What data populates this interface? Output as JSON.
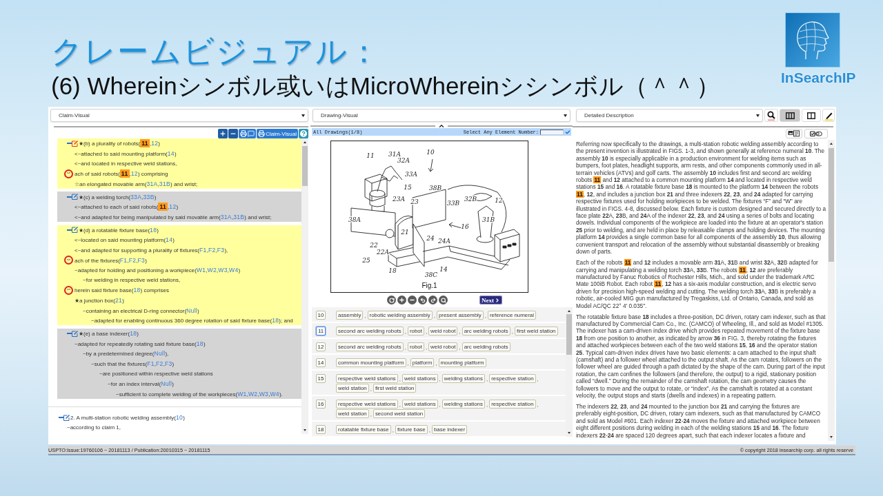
{
  "slide": {
    "title": "クレームビジュアル：",
    "subtitle": "(6) Whereinシンボル或いはMicroWhereinシシンボル（＾＾）"
  },
  "logo": {
    "text": "InSearchIP"
  },
  "claim_panel": {
    "dropdown": "Claim-Visual",
    "visual_button": "Claim-Visual",
    "elements": [
      {
        "expanded": true,
        "selected": true,
        "highlighted": true,
        "parts": [
          {
            "kind": "text",
            "text": "★(b) a plurality of robots("
          },
          {
            "kind": "ref",
            "text": "11",
            "highlighted": true
          },
          {
            "kind": "text",
            "text": ","
          },
          {
            "kind": "ref",
            "text": "12",
            "highlighted": false
          },
          {
            "kind": "text",
            "text": ")"
          }
        ],
        "children": [
          {
            "parts": [
              {
                "kind": "text",
                "text": "<~attached to said mounting platform("
              },
              {
                "kind": "ref",
                "text": "14",
                "highlighted": false
              },
              {
                "kind": "text",
                "text": ")"
              }
            ]
          },
          {
            "parts": [
              {
                "kind": "text",
                "text": "<~and located in respective weld stations,"
              }
            ]
          },
          {
            "marker": "^^",
            "parts": [
              {
                "kind": "text",
                "text": "ach of said robots("
              },
              {
                "kind": "ref",
                "text": "11",
                "highlighted": true
              },
              {
                "kind": "text",
                "text": ","
              },
              {
                "kind": "ref",
                "text": "12",
                "highlighted": false
              },
              {
                "kind": "text",
                "text": ") comprising"
              }
            ]
          },
          {
            "parts": [
              {
                "kind": "text",
                "text": "☆an elongated movable arm("
              },
              {
                "kind": "ref",
                "text": "31A",
                "highlighted": false
              },
              {
                "kind": "text",
                "text": ","
              },
              {
                "kind": "ref",
                "text": "31B",
                "highlighted": false
              },
              {
                "kind": "text",
                "text": ") and wrist;"
              }
            ]
          }
        ]
      },
      {
        "expanded": true,
        "selected": false,
        "highlighted": false,
        "parts": [
          {
            "kind": "text",
            "text": "★(c) a welding torch("
          },
          {
            "kind": "ref",
            "text": "33A",
            "highlighted": false
          },
          {
            "kind": "text",
            "text": ","
          },
          {
            "kind": "ref",
            "text": "33B",
            "highlighted": false
          },
          {
            "kind": "text",
            "text": ")"
          }
        ],
        "children": [
          {
            "parts": [
              {
                "kind": "text",
                "text": "<~attached to each of said robots("
              },
              {
                "kind": "ref",
                "text": "11",
                "highlighted": true
              },
              {
                "kind": "text",
                "text": ","
              },
              {
                "kind": "ref",
                "text": "12",
                "highlighted": false
              },
              {
                "kind": "text",
                "text": ")"
              }
            ]
          },
          {
            "parts": [
              {
                "kind": "text",
                "text": "<~and adapted for being manipulated by said movable arm("
              },
              {
                "kind": "ref",
                "text": "31A",
                "highlighted": false
              },
              {
                "kind": "text",
                "text": ","
              },
              {
                "kind": "ref",
                "text": "31B",
                "highlighted": false
              },
              {
                "kind": "text",
                "text": ") and wrist;"
              }
            ]
          }
        ]
      },
      {
        "expanded": true,
        "selected": false,
        "highlighted": true,
        "parts": [
          {
            "kind": "text",
            "text": "★(d) a rotatable fixture base("
          },
          {
            "kind": "ref",
            "text": "18",
            "highlighted": false
          },
          {
            "kind": "text",
            "text": ")"
          }
        ],
        "children": [
          {
            "parts": [
              {
                "kind": "text",
                "text": "<~located on said mounting platform("
              },
              {
                "kind": "ref",
                "text": "14",
                "highlighted": false
              },
              {
                "kind": "text",
                "text": ")"
              }
            ]
          },
          {
            "parts": [
              {
                "kind": "text",
                "text": "<~and adapted for supporting a plurality of fixtures("
              },
              {
                "kind": "ref",
                "text": "F1",
                "highlighted": false
              },
              {
                "kind": "text",
                "text": ","
              },
              {
                "kind": "ref",
                "text": "F2",
                "highlighted": false
              },
              {
                "kind": "text",
                "text": ","
              },
              {
                "kind": "ref",
                "text": "F3",
                "highlighted": false
              },
              {
                "kind": "text",
                "text": "),"
              }
            ]
          },
          {
            "marker": "^^",
            "parts": [
              {
                "kind": "text",
                "text": "ach of the fixtures("
              },
              {
                "kind": "ref",
                "text": "F1",
                "highlighted": false
              },
              {
                "kind": "text",
                "text": ","
              },
              {
                "kind": "ref",
                "text": "F2",
                "highlighted": false
              },
              {
                "kind": "text",
                "text": ","
              },
              {
                "kind": "ref",
                "text": "F3",
                "highlighted": false
              },
              {
                "kind": "text",
                "text": ")"
              }
            ]
          },
          {
            "parts": [
              {
                "kind": "text",
                "text": "~adapted for holding and positioning a workpiece("
              },
              {
                "kind": "ref",
                "text": "W1",
                "highlighted": false
              },
              {
                "kind": "text",
                "text": ","
              },
              {
                "kind": "ref",
                "text": "W2",
                "highlighted": false
              },
              {
                "kind": "text",
                "text": ","
              },
              {
                "kind": "ref",
                "text": "W3",
                "highlighted": false
              },
              {
                "kind": "text",
                "text": ","
              },
              {
                "kind": "ref",
                "text": "W4",
                "highlighted": false
              },
              {
                "kind": "text",
                "text": ")"
              }
            ],
            "children": [
              {
                "parts": [
                  {
                    "kind": "text",
                    "text": "~for welding in respective weld stations,"
                  }
                ]
              }
            ]
          },
          {
            "marker": "^^",
            "parts": [
              {
                "kind": "text",
                "text": "herein said fixture base("
              },
              {
                "kind": "ref",
                "text": "18",
                "highlighted": false
              },
              {
                "kind": "text",
                "text": ") comprises"
              }
            ]
          },
          {
            "parts": [
              {
                "kind": "text",
                "text": "★a junction box("
              },
              {
                "kind": "ref",
                "text": "21",
                "highlighted": false
              },
              {
                "kind": "text",
                "text": ")"
              }
            ],
            "children": [
              {
                "parts": [
                  {
                    "kind": "text",
                    "text": "~containing an electrical D-ring connector("
                  },
                  {
                    "kind": "ref",
                    "text": "Null",
                    "highlighted": false
                  },
                  {
                    "kind": "text",
                    "text": ")"
                  }
                ],
                "children": [
                  {
                    "parts": [
                      {
                        "kind": "text",
                        "text": "~adapted for enabling continuous 360 degree rotation of said fixture base("
                      },
                      {
                        "kind": "ref",
                        "text": "18",
                        "highlighted": false
                      },
                      {
                        "kind": "text",
                        "text": "); and"
                      }
                    ]
                  }
                ]
              }
            ]
          }
        ]
      },
      {
        "expanded": true,
        "selected": false,
        "highlighted": false,
        "parts": [
          {
            "kind": "text",
            "text": "★(e) a base indexer("
          },
          {
            "kind": "ref",
            "text": "18",
            "highlighted": false
          },
          {
            "kind": "text",
            "text": ")"
          }
        ],
        "children": [
          {
            "parts": [
              {
                "kind": "text",
                "text": "~adapted for repeatedly rotating said fixture base("
              },
              {
                "kind": "ref",
                "text": "18",
                "highlighted": false
              },
              {
                "kind": "text",
                "text": ")"
              }
            ],
            "children": [
              {
                "parts": [
                  {
                    "kind": "text",
                    "text": "~by a predetermined degree("
                  },
                  {
                    "kind": "ref",
                    "text": "Null",
                    "highlighted": false
                  },
                  {
                    "kind": "text",
                    "text": "),"
                  }
                ],
                "children": [
                  {
                    "parts": [
                      {
                        "kind": "text",
                        "text": "~such that the fixtures("
                      },
                      {
                        "kind": "ref",
                        "text": "F1",
                        "highlighted": false
                      },
                      {
                        "kind": "text",
                        "text": ","
                      },
                      {
                        "kind": "ref",
                        "text": "F2",
                        "highlighted": false
                      },
                      {
                        "kind": "text",
                        "text": ","
                      },
                      {
                        "kind": "ref",
                        "text": "F3",
                        "highlighted": false
                      },
                      {
                        "kind": "text",
                        "text": ")"
                      }
                    ],
                    "children": [
                      {
                        "parts": [
                          {
                            "kind": "text",
                            "text": "~are positioned within respective weld stations"
                          }
                        ],
                        "children": [
                          {
                            "parts": [
                              {
                                "kind": "text",
                                "text": "~for an index interval("
                              },
                              {
                                "kind": "ref",
                                "text": "Null",
                                "highlighted": false
                              },
                              {
                                "kind": "text",
                                "text": ")"
                              }
                            ],
                            "children": [
                              {
                                "parts": [
                                  {
                                    "kind": "text",
                                    "text": "~sufficient to complete welding of the workpieces("
                                  },
                                  {
                                    "kind": "ref",
                                    "text": "W1",
                                    "highlighted": false
                                  },
                                  {
                                    "kind": "text",
                                    "text": ","
                                  },
                                  {
                                    "kind": "ref",
                                    "text": "W2",
                                    "highlighted": false
                                  },
                                  {
                                    "kind": "text",
                                    "text": ","
                                  },
                                  {
                                    "kind": "ref",
                                    "text": "W3",
                                    "highlighted": false
                                  },
                                  {
                                    "kind": "text",
                                    "text": ","
                                  },
                                  {
                                    "kind": "ref",
                                    "text": "W4",
                                    "highlighted": false
                                  },
                                  {
                                    "kind": "text",
                                    "text": ")."
                                  }
                                ]
                              }
                            ]
                          }
                        ]
                      }
                    ]
                  }
                ]
              }
            ]
          }
        ]
      }
    ],
    "next_claim": {
      "expanded": true,
      "selected": false,
      "parts": [
        {
          "kind": "text",
          "text": "2. A multi-station robotic welding assembly("
        },
        {
          "kind": "ref",
          "text": "10",
          "highlighted": false
        },
        {
          "kind": "text",
          "text": ")"
        }
      ],
      "children": [
        {
          "parts": [
            {
              "kind": "text",
              "text": "~according to claim 1,"
            }
          ]
        }
      ]
    }
  },
  "drawing_panel": {
    "dropdown": "Drawing-Visual",
    "drawing_count": "All Drawings(1/8)",
    "element_prompt": "Select Any Element Number:",
    "figure": {
      "caption": "Fig.1",
      "labels": [
        "11",
        "31A",
        "32A",
        "33A",
        "10",
        "15",
        "23A",
        "23",
        "38B",
        "33B",
        "32B",
        "12",
        "38A",
        "21",
        "16",
        "31B",
        "22",
        "22A",
        "25",
        "24",
        "24A",
        "18",
        "38C",
        "14"
      ]
    },
    "next_button": "Next",
    "elements": [
      {
        "number": "10",
        "selected": false,
        "terms": [
          {
            "text": "assembly",
            "separator": ","
          },
          {
            "text": "robotic welding assembly",
            "separator": ","
          },
          {
            "text": "present assembly",
            "separator": ","
          },
          {
            "text": "reference numeral"
          }
        ]
      },
      {
        "number": "11",
        "selected": true,
        "terms": [
          {
            "text": "second arc welding robots",
            "separator": ","
          },
          {
            "text": "robot",
            "separator": ","
          },
          {
            "text": "weld robot",
            "separator": ","
          },
          {
            "text": "arc welding robots",
            "separator": ","
          },
          {
            "text": "first weld station"
          }
        ]
      },
      {
        "number": "12",
        "selected": false,
        "terms": [
          {
            "text": "second arc welding robots",
            "separator": ","
          },
          {
            "text": "robot",
            "separator": ","
          },
          {
            "text": "weld robot",
            "separator": ","
          },
          {
            "text": "arc welding robots"
          }
        ]
      },
      {
        "number": "14",
        "selected": false,
        "terms": [
          {
            "text": "common mounting platform",
            "separator": ","
          },
          {
            "text": "platform",
            "separator": ","
          },
          {
            "text": "mounting platform"
          }
        ]
      },
      {
        "number": "15",
        "selected": false,
        "terms": [
          {
            "text": "respective weld stations",
            "separator": ","
          },
          {
            "text": "weld stations",
            "separator": ","
          },
          {
            "text": "welding stations",
            "separator": ","
          },
          {
            "text": "respective station",
            "separator": ","
          },
          {
            "text": "weld station",
            "separator": ","
          },
          {
            "text": "first weld station"
          }
        ]
      },
      {
        "number": "16",
        "selected": false,
        "terms": [
          {
            "text": "respective weld stations",
            "separator": ","
          },
          {
            "text": "weld stations",
            "separator": ","
          },
          {
            "text": "welding stations",
            "separator": ","
          },
          {
            "text": "respective station",
            "separator": ","
          },
          {
            "text": "weld station",
            "separator": ","
          },
          {
            "text": "second weld station"
          }
        ]
      },
      {
        "number": "18",
        "selected": false,
        "terms": [
          {
            "text": "rotatable fixture base",
            "separator": ","
          },
          {
            "text": "fixture base",
            "separator": ","
          },
          {
            "text": "base indexer"
          }
        ]
      }
    ]
  },
  "description_panel": {
    "dropdown": "Detailed Description",
    "layout_buttons": [
      {
        "kind": "three-column",
        "selected": true
      },
      {
        "kind": "two-column",
        "selected": false
      }
    ],
    "paragraphs": [
      {
        "parts": [
          {
            "kind": "text",
            "text": "Referring now specifically to the drawings, a multi-station robotic welding assembly according to the present invention is illustrated in FIGS. 1-3, and shown generally at reference numeral **10**. The assembly **10** is especially applicable in a production environment for welding items such as bumpers, foot plates, headlight supports, arm rests, and other components commonly used in all-terrain vehicles (ATVs) and golf carts. The assembly **10** includes first and second arc welding robots "
          },
          {
            "kind": "mark",
            "text": "11"
          },
          {
            "kind": "text",
            "text": " and **12** attached to a common mounting platform **14** and located in respective weld stations **15** and **16**. A rotatable fixture base **18** is mounted to the platform **14** between the robots "
          },
          {
            "kind": "mark",
            "text": "11"
          },
          {
            "kind": "text",
            "text": ", **12**, and includes a junction box **21** and three indexers **22**, **23**, and **24** adapted for carrying respective fixtures used for holding workpieces to be welded. The fixtures “F” and “W” are illustrated in FIGS. 4-8, discussed below. Each fixture is custom designed and secured directly to a face plate **22**A, **23**B, and **24**A of the indexer **22**, **23**, and **24** using a series of bolts and locating dowels. Individual components of the workpiece are loaded into the fixture at an operator's station **25** prior to welding, and are held in place by releasable clamps and holding devices. The mounting platform **14** provides a single common base for all components of the assembly **10**, thus allowing convenient transport and relocation of the assembly without substantial disassembly or breaking down of parts."
          }
        ]
      },
      {
        "parts": [
          {
            "kind": "text",
            "text": "Each of the robots "
          },
          {
            "kind": "mark",
            "text": "11"
          },
          {
            "kind": "text",
            "text": " and **12** includes a movable arm **31**A, **31**B and wrist **32**A, **32**B adapted for carrying and manipulating a welding torch **33**A, **33**B. The robots "
          },
          {
            "kind": "mark",
            "text": "11"
          },
          {
            "kind": "text",
            "text": ", **12** are preferably manufactured by Fanuc Robotics of Rochester Hills, Mich., and sold under the trademark ARC Mate 100iB Robot. Each robot "
          },
          {
            "kind": "mark",
            "text": "11"
          },
          {
            "kind": "text",
            "text": ", **12** has a six-axis modular construction, and is electric servo driven for precision high-speed welding and cutting. The welding torch **33**A, **33**B is preferably a robotic, air-cooled MIG gun manufactured by Tregaskiss, Ltd. of Ontario, Canada, and sold as Model AC/QC 22° 4' 0.035\"."
          }
        ]
      },
      {
        "parts": [
          {
            "kind": "text",
            "text": "The rotatable fixture base **18** includes a three-position, DC driven, rotary cam indexer, such as that manufactured by Commercial Cam Co., Inc. (CAMCO) of Wheeling, Ill., and sold as Model #1305. The indexer has a cam-driven index drive which provides repeated movement of the fixture base **18** from one position to another, as indicated by arrow **36** in FIG. 3, thereby rotating the fixtures and attached workpieces between each of the two weld stations **15**, **16** and the operator station **25**. Typical cam-driven index drives have two basic elements: a cam attached to the input shaft (camshaft) and a follower wheel attached to the output shaft. As the cam rotates, followers on the follower wheel are guided through a path dictated by the shape of the cam. During part of the input rotation, the cam confines the followers (and therefore, the output) to a rigid, stationary position called “dwell.” During the remainder of the camshaft rotation, the cam geometry causes the followers to move and the output to rotate, or “index”. As the camshaft is rotated at a constant velocity, the output stops and starts (dwells and indexes) in a repeating pattern."
          }
        ]
      },
      {
        "parts": [
          {
            "kind": "text",
            "text": "The indexers **22**, **23**, and **24** mounted to the junction box **21** and carrying the fixtures are preferably eight-position, DC driven, rotary cam indexers, such as that manufactured by CAMCO and sold as Model #601. Each indexer **22**-**24** moves the fixture and attached workpiece between eight different positions during welding in each of the welding stations **15** and **16**. The fixture indexers **22**-**24** are spaced 120 degrees apart, such that each indexer locates a fixture and"
          }
        ]
      }
    ]
  },
  "footer": {
    "coverage": "USPTO:Issue:19760106 ~ 20181113 / Publication:20010315 ~ 20181115",
    "copyright": "© copyright 2018 insearchip corp. all rights reserve"
  }
}
